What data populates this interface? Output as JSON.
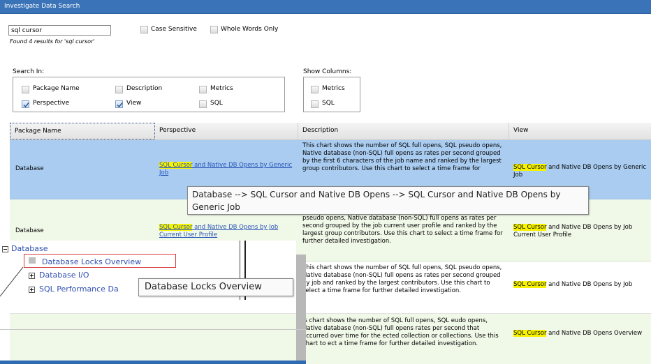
{
  "window": {
    "title": "Investigate Data Search"
  },
  "search": {
    "query": "sql cursor",
    "result_summary": "Found 4 results for 'sql cursor'",
    "case_sensitive_label": "Case Sensitive",
    "whole_words_label": "Whole Words Only"
  },
  "search_in": {
    "label": "Search In:",
    "options": [
      {
        "label": "Package Name",
        "checked": false
      },
      {
        "label": "Description",
        "checked": false
      },
      {
        "label": "Metrics",
        "checked": false
      },
      {
        "label": "Perspective",
        "checked": true
      },
      {
        "label": "View",
        "checked": true
      },
      {
        "label": "SQL",
        "checked": false
      }
    ]
  },
  "show_columns": {
    "label": "Show Columns:",
    "options": [
      {
        "label": "Metrics",
        "checked": false
      },
      {
        "label": "SQL",
        "checked": false
      }
    ]
  },
  "table": {
    "columns": [
      "Package Name",
      "Perspective",
      "Description",
      "View"
    ],
    "rows": [
      {
        "package": "Database",
        "perspective_hl": "SQL Cursor",
        "perspective_rest": " and Native DB Opens by Generic Job",
        "description": "This chart shows the number of SQL full opens, SQL pseudo opens, Native database (non-SQL) full opens as rates per second grouped by the first 6 characters of the job name and ranked by the largest group contributors. Use this chart to select a time frame for",
        "view_hl": "SQL Cursor",
        "view_rest": " and Native DB Opens by Generic Job"
      },
      {
        "package": "Database",
        "perspective_hl": "SQL Cursor",
        "perspective_rest": " and Native DB Opens by Job Current User Profile",
        "description": "pseudo opens, Native database (non-SQL) full opens as rates per second grouped by the job current user profile and ranked by the largest group contributors. Use this chart to select a time frame for further detailed investigation.",
        "view_hl": "SQL Cursor",
        "view_rest": " and Native DB Opens by Job Current User Profile"
      },
      {
        "package": "",
        "perspective_hl": "",
        "perspective_rest": "",
        "description": "This chart shows the number of SQL full opens, SQL pseudo opens, Native database (non-SQL) full opens as rates per second grouped by job and ranked by the largest contributors. Use this chart to select a time frame for further detailed investigation.",
        "view_hl": "SQL Cursor",
        "view_rest": " and Native DB Opens by Job"
      },
      {
        "package": "",
        "perspective_hl": "",
        "perspective_rest": "",
        "description": "is chart shows the number of SQL full opens, SQL eudo opens, Native database (non-SQL) full opens rates per second that occurred over time for the ected collection or collections. Use this chart to ect a time frame for further detailed investigation.",
        "view_hl": "SQL Cursor",
        "view_rest": " and Native DB Opens Overview"
      }
    ]
  },
  "tooltip_path": "Database --> SQL Cursor and Native DB Opens --> SQL Cursor and Native DB Opens by Generic Job",
  "tree": {
    "root": "Database",
    "items": [
      "Database Locks Overview",
      "Database I/O",
      "SQL Performance Da"
    ],
    "tooltip": "Database Locks Overview"
  },
  "colors": {
    "title_bar": "#3a73b8",
    "selected_row": "#a9ccf0",
    "highlight": "#f7f300",
    "link": "#2a55b8"
  }
}
